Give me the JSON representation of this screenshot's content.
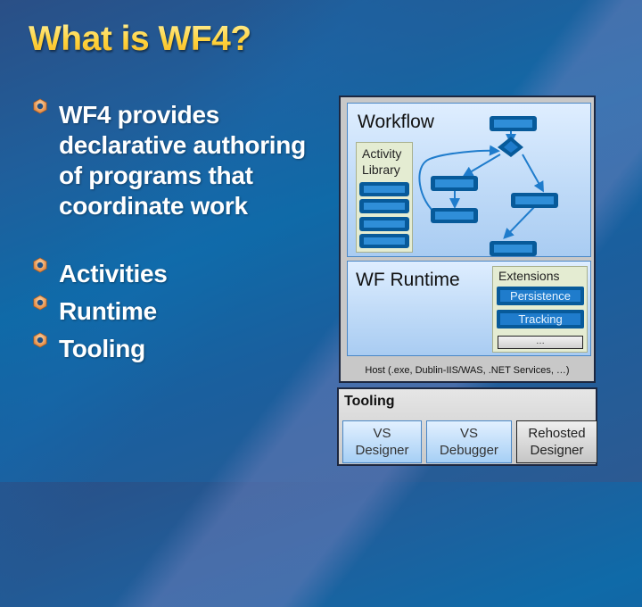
{
  "slide": {
    "title": "What is WF4?",
    "bullets": [
      {
        "icon": "hex-nut-bullet-icon",
        "text": "WF4 provides declarative authoring of programs that coordinate work"
      },
      {
        "icon": "hex-nut-bullet-icon",
        "text": "Activities"
      },
      {
        "icon": "hex-nut-bullet-icon",
        "text": "Runtime"
      },
      {
        "icon": "hex-nut-bullet-icon",
        "text": "Tooling"
      }
    ]
  },
  "diagram": {
    "workflow": {
      "title": "Workflow",
      "activity_library": {
        "title_line1": "Activity",
        "title_line2": "Library",
        "item_count": 4
      },
      "flowchart_icons": [
        "activity-box",
        "decision-diamond",
        "activity-box",
        "activity-box",
        "activity-box",
        "activity-box"
      ]
    },
    "runtime": {
      "title": "WF Runtime",
      "extensions": {
        "title": "Extensions",
        "items": [
          "Persistence",
          "Tracking"
        ],
        "more": "…"
      }
    },
    "host": "Host (.exe, Dublin-IIS/WAS, .NET Services, …)"
  },
  "tooling": {
    "title": "Tooling",
    "items": [
      {
        "line1": "VS",
        "line2": "Designer"
      },
      {
        "line1": "VS",
        "line2": "Debugger"
      },
      {
        "line1": "Rehosted",
        "line2": "Designer"
      }
    ]
  },
  "colors": {
    "title_gold": "#ffd23a",
    "activity_dark_blue": "#075a9a",
    "activity_light_blue": "#2f8ed8",
    "bullet_orange": "#f0a060"
  }
}
